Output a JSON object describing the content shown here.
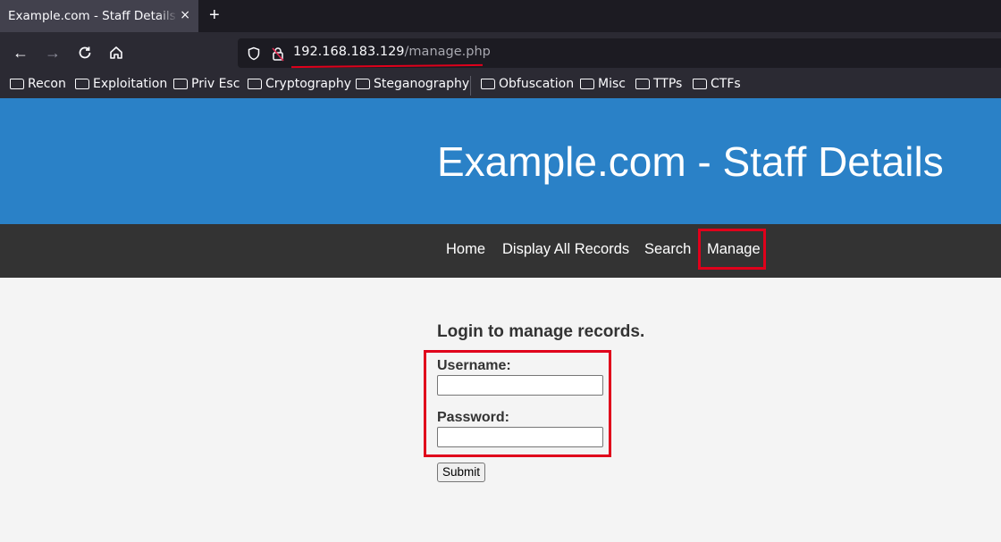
{
  "browser": {
    "tab_title": "Example.com - Staff Details - Mozilla Firefox",
    "tab_close": "×",
    "new_tab": "+",
    "url_host": "192.168.183.129",
    "url_path": "/manage.php",
    "bookmarks": [
      "Recon",
      "Exploitation",
      "Priv Esc",
      "Cryptography",
      "Steganography",
      "Obfuscation",
      "Misc",
      "TTPs",
      "CTFs"
    ]
  },
  "site": {
    "title": "Example.com - Staff Details",
    "nav": [
      "Home",
      "Display All Records",
      "Search",
      "Manage"
    ]
  },
  "login": {
    "heading": "Login to manage records.",
    "username_label": "Username:",
    "username_value": "",
    "password_label": "Password:",
    "password_value": "",
    "submit_label": "Submit"
  },
  "annotation_color": "#e0001b",
  "header_color": "#2a81c7"
}
